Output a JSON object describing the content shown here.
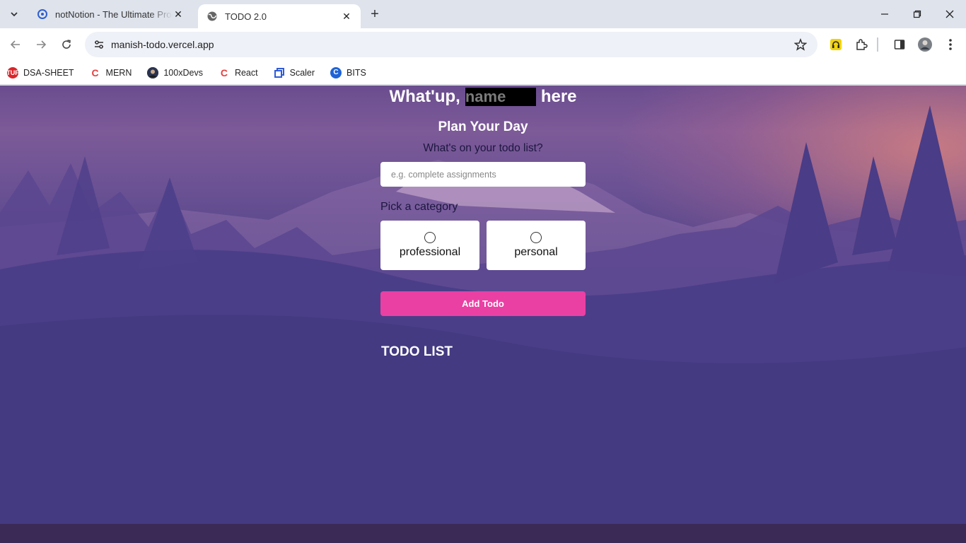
{
  "browser": {
    "tabs": [
      {
        "title": "notNotion - The Ultimate Productivity",
        "active": false
      },
      {
        "title": "TODO 2.0",
        "active": true
      }
    ],
    "url": "manish-todo.vercel.app",
    "bookmarks": [
      {
        "label": "DSA-SHEET",
        "icon_color": "#d9252a",
        "icon_text": "TUF"
      },
      {
        "label": "MERN",
        "icon_color": "#e63e3e",
        "icon_text": "C"
      },
      {
        "label": "100xDevs",
        "icon_color": "#1e2a44",
        "icon_text": ""
      },
      {
        "label": "React",
        "icon_color": "#e63e3e",
        "icon_text": "C"
      },
      {
        "label": "Scaler",
        "icon_color": "#2e5bd8",
        "icon_text": ""
      },
      {
        "label": "BITS",
        "icon_color": "#1f63d6",
        "icon_text": "C"
      }
    ]
  },
  "app": {
    "greeting_prefix": "What'up,",
    "name_placeholder": "name",
    "greeting_suffix": "here",
    "plan_title": "Plan Your Day",
    "question": "What's on your todo list?",
    "todo_placeholder": "e.g. complete assignments",
    "category_label": "Pick a category",
    "categories": [
      "professional",
      "personal"
    ],
    "add_button": "Add Todo",
    "list_title": "TODO LIST"
  },
  "colors": {
    "accent_button": "#ea40a4",
    "name_input_bg": "#000000"
  }
}
